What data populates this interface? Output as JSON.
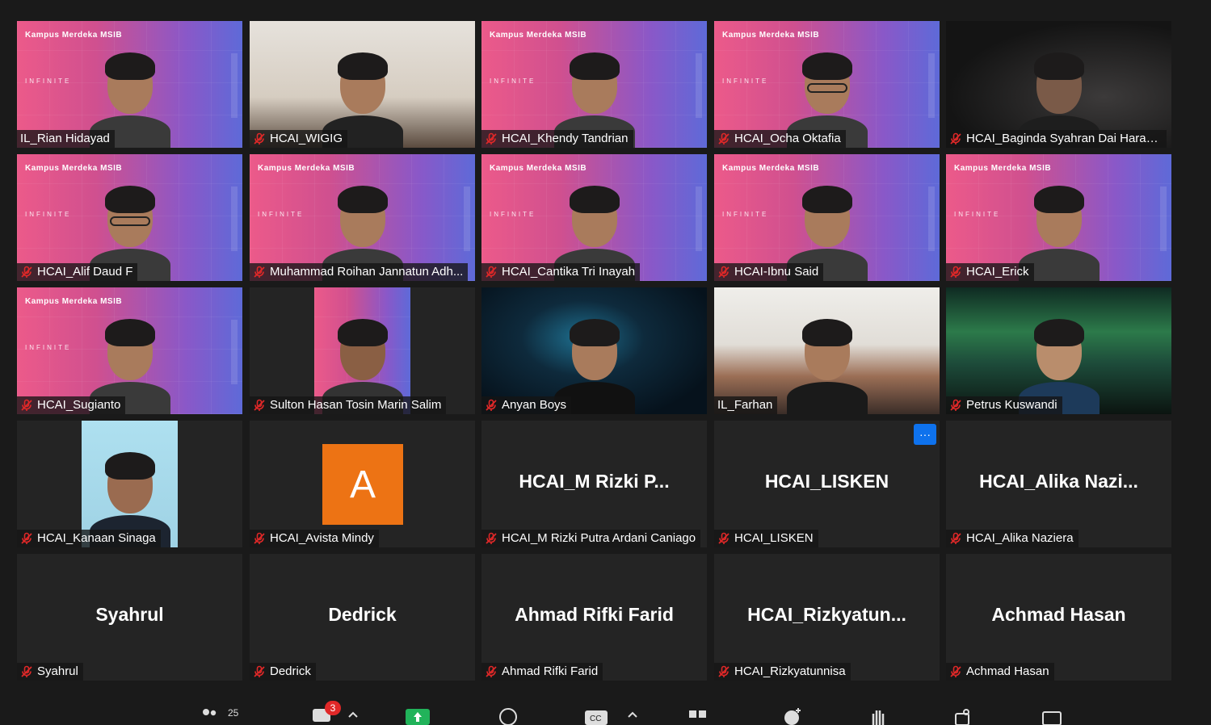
{
  "participants_count": "25",
  "chat_badge": "3",
  "avatar_letter": "A",
  "brand": {
    "logo": "Kampus Merdeka MSIB",
    "tagline": "INFINITE"
  },
  "tiles": [
    {
      "label": "IL_Rian Hidayad",
      "style": "brand",
      "muted": false
    },
    {
      "label": "HCAI_WIGIG",
      "style": "room",
      "muted": true
    },
    {
      "label": "HCAI_Khendy Tandrian",
      "style": "brand",
      "muted": true
    },
    {
      "label": "HCAI_Ocha Oktafia",
      "style": "brand",
      "muted": true
    },
    {
      "label": "HCAI_Baginda Syahran Dai Harah...",
      "style": "dark",
      "muted": true
    },
    {
      "label": "HCAI_Alif Daud F",
      "style": "brand",
      "muted": true
    },
    {
      "label": "Muhammad Roihan Jannatun Adh...",
      "style": "brand",
      "muted": true
    },
    {
      "label": "HCAI_Cantika Tri Inayah",
      "style": "brand",
      "muted": true
    },
    {
      "label": "HCAI-Ibnu Said",
      "style": "brand",
      "muted": true
    },
    {
      "label": "HCAI_Erick",
      "style": "brand",
      "muted": true
    },
    {
      "label": "HCAI_Sugianto",
      "style": "brand",
      "muted": true
    },
    {
      "label": "Sulton Hasan Tosin Marin Salim",
      "style": "sulton",
      "muted": true
    },
    {
      "label": "Anyan Boys",
      "style": "tech",
      "muted": true
    },
    {
      "label": "IL_Farhan",
      "style": "office",
      "muted": false,
      "active": true
    },
    {
      "label": "Petrus Kuswandi",
      "style": "aurora",
      "muted": true
    },
    {
      "label": "HCAI_Kanaan Sinaga",
      "style": "sky",
      "muted": true
    },
    {
      "label": "HCAI_Avista Mindy",
      "style": "avatar",
      "muted": true
    },
    {
      "label": "HCAI_M Rizki Putra Ardani Caniago",
      "style": "name",
      "center": "HCAI_M  Rizki  P...",
      "muted": true
    },
    {
      "label": "HCAI_LISKEN",
      "style": "name",
      "center": "HCAI_LISKEN",
      "muted": true,
      "more": true
    },
    {
      "label": "HCAI_Alika Naziera",
      "style": "name",
      "center": "HCAI_Alika  Nazi...",
      "muted": true
    },
    {
      "label": "Syahrul",
      "style": "name",
      "center": "Syahrul",
      "muted": true
    },
    {
      "label": "Dedrick",
      "style": "name",
      "center": "Dedrick",
      "muted": true
    },
    {
      "label": "Ahmad Rifki Farid",
      "style": "name",
      "center": "Ahmad Rifki Farid",
      "muted": true
    },
    {
      "label": "HCAI_Rizkyatunnisa",
      "style": "name",
      "center": "HCAI_Rizkyatun...",
      "muted": true
    },
    {
      "label": "Achmad Hasan",
      "style": "name",
      "center": "Achmad Hasan",
      "muted": true
    }
  ],
  "colors": {
    "active_border": "#c6e03a",
    "more_button": "#0e72ed",
    "muted_icon": "#e02828",
    "avatar_bg": "#ed7314"
  }
}
